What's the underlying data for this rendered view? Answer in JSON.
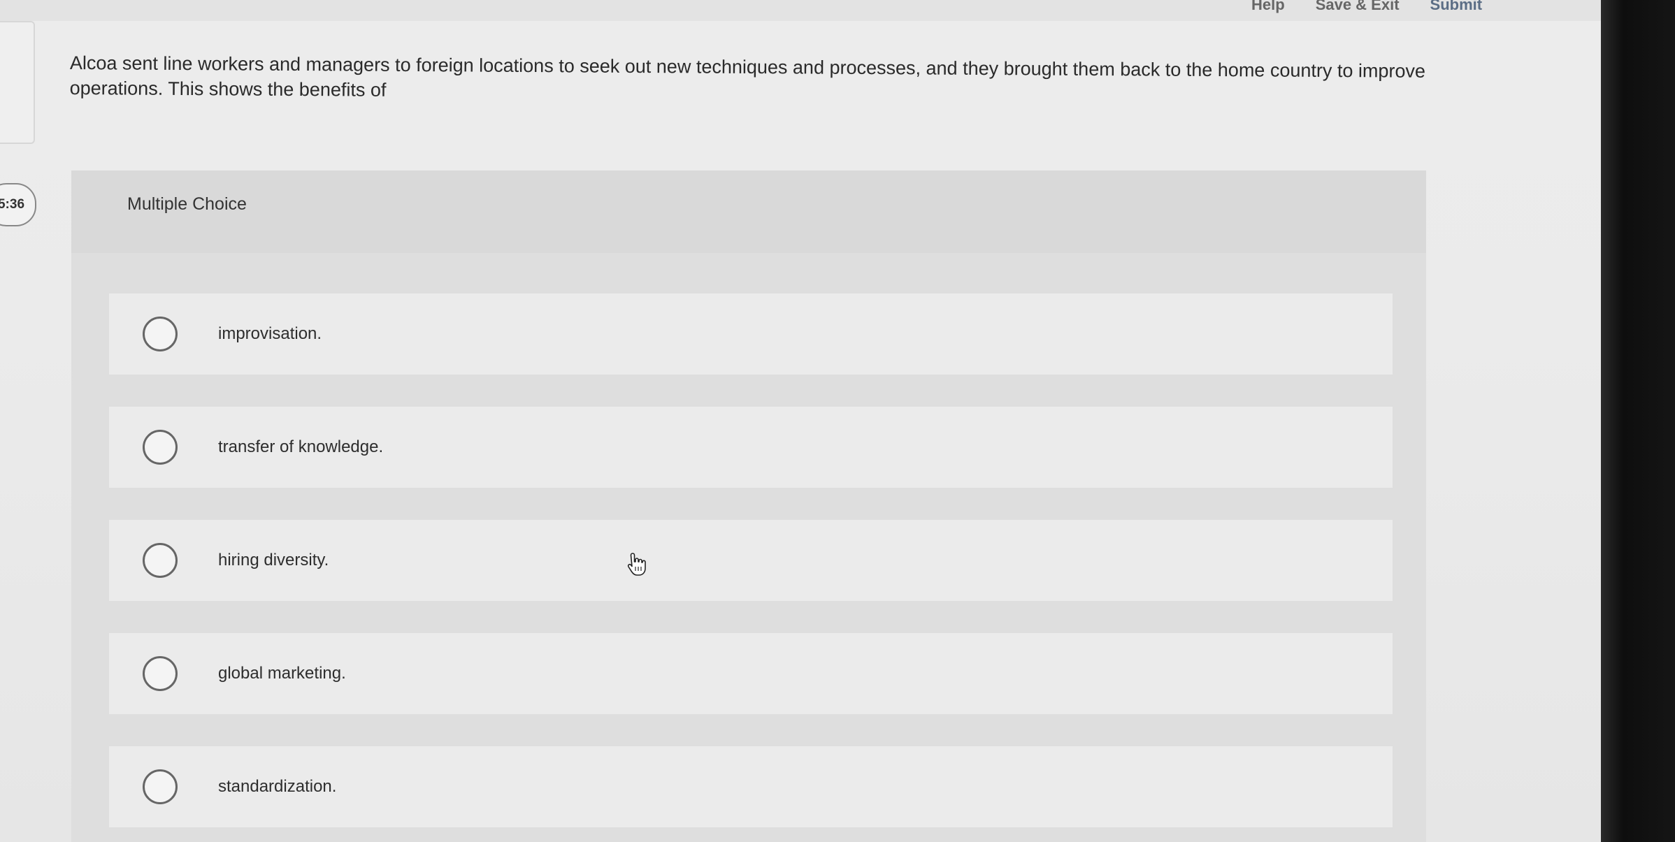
{
  "header": {
    "links": [
      {
        "name": "help-link",
        "label": "Help"
      },
      {
        "name": "save-exit-link",
        "label": "Save & Exit"
      },
      {
        "name": "submit-link",
        "label": "Submit"
      }
    ]
  },
  "timer": {
    "text": "5:36"
  },
  "question": {
    "text": "Alcoa sent line workers and managers to foreign locations to seek out new techniques and processes, and they brought them back to the home country to improve operations. This shows the benefits of"
  },
  "choice": {
    "type_label": "Multiple Choice",
    "options": [
      {
        "label": "improvisation."
      },
      {
        "label": "transfer of knowledge."
      },
      {
        "label": "hiring diversity."
      },
      {
        "label": "global marketing."
      },
      {
        "label": "standardization."
      }
    ]
  },
  "colors": {
    "background": "#ebebeb",
    "card": "#dedede",
    "option": "#ebebeb",
    "submit": "#5b6d85"
  }
}
